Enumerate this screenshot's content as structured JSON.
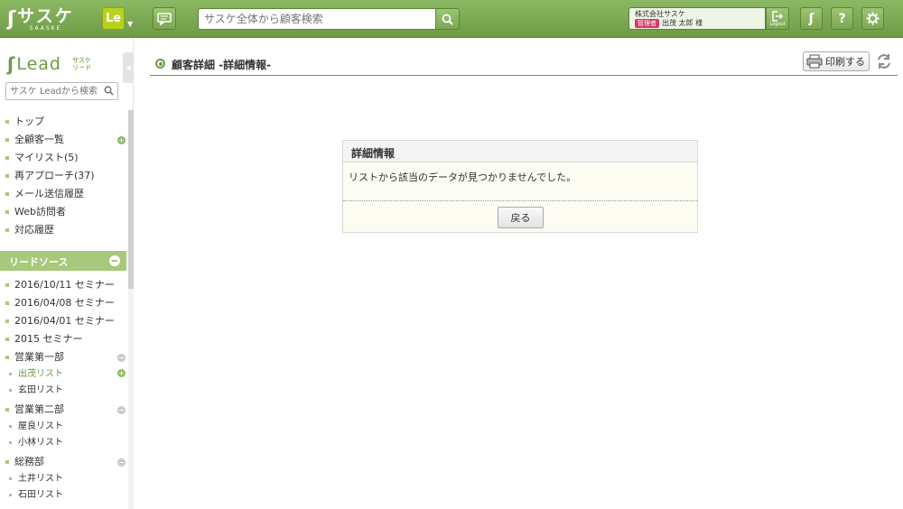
{
  "header": {
    "logo_main": "サスケ",
    "logo_sub": "SAASKE",
    "app_switch_label": "Le",
    "search_placeholder": "サスケ全体から顧客検索",
    "user": {
      "company": "株式会社サスケ",
      "role": "管理者",
      "name": "出茂 太郎 様"
    },
    "logout_label": "Logout",
    "help_label": "?"
  },
  "sidebar": {
    "logo_text": "Lead",
    "logo_kana_top": "サスケ",
    "logo_kana_bottom": "リード",
    "search_placeholder": "サスケ Leadから検索",
    "nav": [
      "トップ",
      "全顧客一覧",
      "マイリスト(5)",
      "再アプローチ(37)",
      "メール送信履歴",
      "Web訪問者",
      "対応履歴"
    ],
    "section_title": "リードソース",
    "sources": [
      "2016/10/11 セミナー",
      "2016/04/08 セミナー",
      "2016/04/01 セミナー",
      "2015 セミナー"
    ],
    "groups": [
      {
        "name": "営業第一部",
        "lists": [
          "出茂リスト",
          "玄田リスト"
        ]
      },
      {
        "name": "営業第二部",
        "lists": [
          "屋良リスト",
          "小林リスト"
        ]
      },
      {
        "name": "総務部",
        "lists": [
          "土井リスト",
          "石田リスト"
        ]
      }
    ]
  },
  "main": {
    "title": "顧客詳細 -詳細情報-",
    "print_label": "印刷する",
    "panel": {
      "title": "詳細情報",
      "message": "リストから該当のデータが見つかりませんでした。",
      "back_label": "戻る"
    }
  },
  "colors": {
    "brand_green": "#6e9b45",
    "accent_lime": "#b7d21e",
    "role_badge": "#d9376b"
  }
}
